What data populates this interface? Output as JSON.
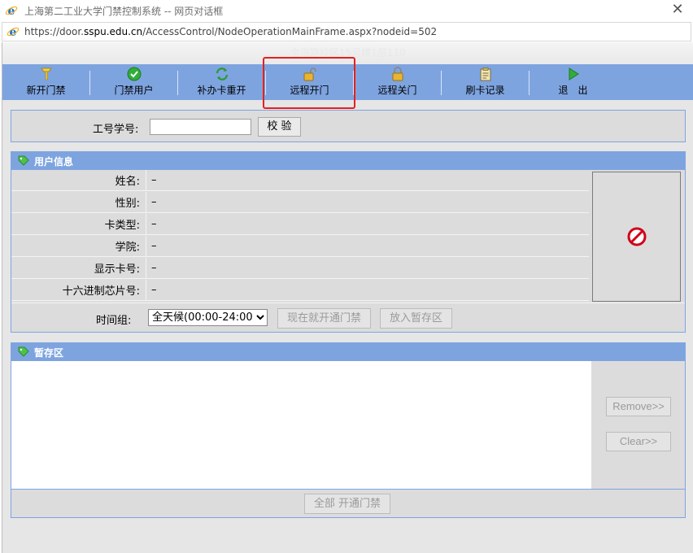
{
  "window": {
    "title": "上海第二工业大学门禁控制系统 -- 网页对话框",
    "url_prefix": "https://door.",
    "url_domain": "sspu.edu.cn",
    "url_path": "/AccessControl/NodeOperationMainFrame.aspx?nodeid=502"
  },
  "location": "金海路校区15号楼1层110",
  "toolbar": {
    "items": [
      {
        "label": "新开门禁",
        "icon": "key-icon"
      },
      {
        "label": "门禁用户",
        "icon": "check-circle-icon"
      },
      {
        "label": "补办卡重开",
        "icon": "refresh-icon"
      },
      {
        "label": "远程开门",
        "icon": "unlock-icon"
      },
      {
        "label": "远程关门",
        "icon": "lock-icon"
      },
      {
        "label": "刷卡记录",
        "icon": "clipboard-icon"
      },
      {
        "label": "退　出",
        "icon": "play-arrow-icon"
      }
    ]
  },
  "verify": {
    "label": "工号学号:",
    "input_value": "",
    "button": "校 验"
  },
  "user_info": {
    "header": "用户信息",
    "rows": [
      {
        "key": "姓名:",
        "value": "–"
      },
      {
        "key": "性别:",
        "value": "–"
      },
      {
        "key": "卡类型:",
        "value": "–"
      },
      {
        "key": "学院:",
        "value": "–"
      },
      {
        "key": "显示卡号:",
        "value": "–"
      },
      {
        "key": "十六进制芯片号:",
        "value": "–"
      }
    ],
    "time_group_label": "时间组:",
    "time_group_selected": "全天候(00:00-24:00)",
    "open_now_button": "现在就开通门禁",
    "stash_button": "放入暂存区"
  },
  "staging": {
    "header": "暂存区",
    "remove_button": "Remove>>",
    "clear_button": "Clear>>",
    "open_all_button": "全部 开通门禁"
  },
  "colors": {
    "accent": "#7ea4e0",
    "highlight": "#e5201e"
  }
}
